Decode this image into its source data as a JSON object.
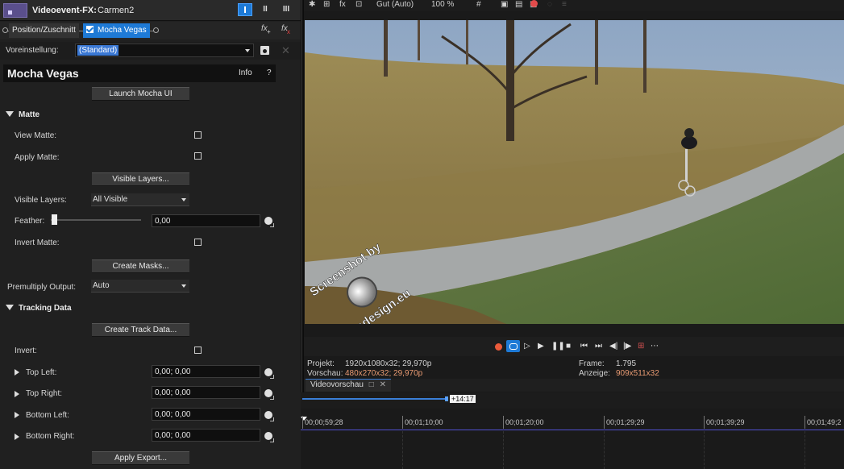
{
  "fx_window": {
    "title": "Videoevent-FX:",
    "event_name": "Carmen2",
    "btn_mid": "II",
    "btn_right": "III"
  },
  "chain": {
    "item1": "Position/Zuschnitt",
    "item2": "Mocha Vegas"
  },
  "preset": {
    "label": "Voreinstellung:",
    "value": "(Standard)"
  },
  "plugin": {
    "title": "Mocha Vegas",
    "info_label": "Info",
    "help_label": "?",
    "launch_button": "Launch Mocha UI"
  },
  "matte": {
    "header": "Matte",
    "view_matte_label": "View Matte:",
    "apply_matte_label": "Apply Matte:",
    "visible_layers_button": "Visible Layers...",
    "visible_layers_label": "Visible Layers:",
    "visible_layers_value": "All Visible",
    "feather_label": "Feather:",
    "feather_value": "0,00",
    "invert_matte_label": "Invert Matte:",
    "create_masks_button": "Create Masks...",
    "premultiply_label": "Premultiply Output:",
    "premultiply_value": "Auto"
  },
  "tracking": {
    "header": "Tracking Data",
    "create_track_button": "Create Track Data...",
    "invert_label": "Invert:",
    "top_left_label": "Top Left:",
    "top_left_value": "0,00; 0,00",
    "top_right_label": "Top Right:",
    "top_right_value": "0,00; 0,00",
    "bottom_left_label": "Bottom Left:",
    "bottom_left_value": "0,00; 0,00",
    "bottom_right_label": "Bottom Right:",
    "bottom_right_value": "0,00; 0,00",
    "apply_export_button": "Apply Export..."
  },
  "preview_toolbar": {
    "quality": "Gut (Auto)",
    "zoom": "100 %"
  },
  "watermark": {
    "line1": "Screenshot by",
    "line2": "Ahadesign.eu"
  },
  "info": {
    "projekt_label": "Projekt:",
    "projekt_value": "1920x1080x32; 29,970p",
    "vorschau_label": "Vorschau:",
    "vorschau_value": "480x270x32; 29,970p",
    "frame_label": "Frame:",
    "frame_value": "1.795",
    "anzeige_label": "Anzeige:",
    "anzeige_value": "909x511x32"
  },
  "tab": {
    "label": "Videovorschau"
  },
  "timeline": {
    "marker": "+14:17",
    "ticks": [
      "00;00;59;28",
      "00;01;10;00",
      "00;01;20;00",
      "00;01;29;29",
      "00;01;39;29",
      "00;01;49;2"
    ]
  },
  "colors": {
    "accent_blue": "#1e7ad6",
    "orange_text": "#e89a72",
    "record_red": "#e24b4b"
  }
}
